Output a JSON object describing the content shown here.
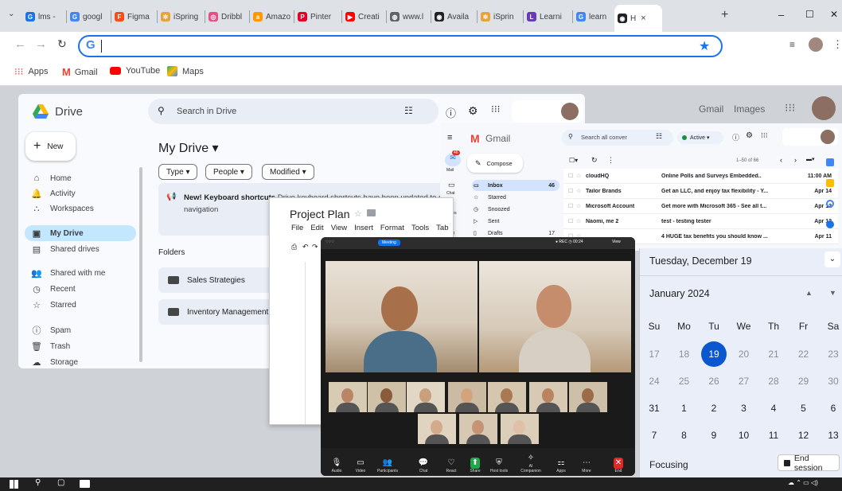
{
  "browser": {
    "tabs": [
      {
        "label": "lms -",
        "color": "#1a73e8",
        "glyph": "G"
      },
      {
        "label": "googl",
        "color": "#4285f4",
        "glyph": "G"
      },
      {
        "label": "Figma",
        "color": "#f24e1e",
        "glyph": "F"
      },
      {
        "label": "iSpring",
        "color": "#e9a23b",
        "glyph": "✲"
      },
      {
        "label": "Dribbl",
        "color": "#ea4c89",
        "glyph": "◎"
      },
      {
        "label": "Amazo",
        "color": "#ff9900",
        "glyph": "a"
      },
      {
        "label": "Pinter",
        "color": "#e60023",
        "glyph": "P"
      },
      {
        "label": "Creati",
        "color": "#ff0000",
        "glyph": "▶"
      },
      {
        "label": "www.l",
        "color": "#5f6368",
        "glyph": "◍"
      },
      {
        "label": "Availa",
        "color": "#202124",
        "glyph": "◉"
      },
      {
        "label": "iSprin",
        "color": "#e9a23b",
        "glyph": "✲"
      },
      {
        "label": "Learni",
        "color": "#673ab7",
        "glyph": "L"
      },
      {
        "label": "learn",
        "color": "#4285f4",
        "glyph": "G"
      },
      {
        "label": "H",
        "color": "#202124",
        "glyph": "◉"
      }
    ],
    "new_tab": "+",
    "tab_close": "×",
    "menu_caret": "⌄",
    "omnibox_prefix": "G",
    "window_controls": [
      "–",
      "☐",
      "✕"
    ],
    "bookmarks": [
      {
        "label": "Apps",
        "icon": "apps-grid-icon"
      },
      {
        "label": "Gmail",
        "icon": "gmail-icon"
      },
      {
        "label": "YouTube",
        "icon": "youtube-icon"
      },
      {
        "label": "Maps",
        "icon": "maps-icon"
      }
    ],
    "star": "★"
  },
  "drive": {
    "title": "Drive",
    "search_placeholder": "Search in Drive",
    "new_button": "New",
    "nav": [
      {
        "label": "Home",
        "icon": "⌂"
      },
      {
        "label": "Activity",
        "icon": "🔔"
      },
      {
        "label": "Workspaces",
        "icon": "∴"
      },
      {
        "label": "My Drive",
        "icon": "▣",
        "active": true
      },
      {
        "label": "Shared drives",
        "icon": "▤"
      },
      {
        "label": "Shared with me",
        "icon": "👥"
      },
      {
        "label": "Recent",
        "icon": "◷"
      },
      {
        "label": "Starred",
        "icon": "☆"
      },
      {
        "label": "Spam",
        "icon": "ⓘ"
      },
      {
        "label": "Trash",
        "icon": "🗑"
      },
      {
        "label": "Storage",
        "icon": "☁"
      }
    ],
    "heading": "My Drive ▾",
    "filters": [
      "Type ▾",
      "People ▾",
      "Modified ▾"
    ],
    "banner_bold": "New! Keyboard shortcuts",
    "banner_text": "Drive keyboard shortcuts have been updated to give",
    "banner_text2": "navigation",
    "folders_label": "Folders",
    "folders": [
      "Sales Strategies",
      "Inventory Management"
    ],
    "header_links": [
      "Gmail",
      "Images"
    ]
  },
  "gmail": {
    "title": "Gmail",
    "search_placeholder": "Search all conver",
    "status": "Active ▾",
    "compose": "Compose",
    "rail": [
      "Mail",
      "Chat",
      "Spaces"
    ],
    "mail_badge": "46",
    "labels": [
      {
        "label": "Inbox",
        "count": "46",
        "icon": "▭"
      },
      {
        "label": "Starred",
        "count": "",
        "icon": "☆"
      },
      {
        "label": "Snoozed",
        "count": "",
        "icon": "◷"
      },
      {
        "label": "Sent",
        "count": "",
        "icon": "▷"
      },
      {
        "label": "Drafts",
        "count": "17",
        "icon": "▯"
      }
    ],
    "pager": "1–50 of 66",
    "emails": [
      {
        "sender": "cloudHQ",
        "subject": "Online Polls and Surveys Embedded..",
        "date": "11:00 AM"
      },
      {
        "sender": "Tailor Brands",
        "subject": "Get an LLC, and enjoy tax flexibility - Y...",
        "date": "Apr 14"
      },
      {
        "sender": "Microsoft Account",
        "subject": "Get more with Microsoft 365 - See all t...",
        "date": "Apr 12"
      },
      {
        "sender": "Naomi, me 2",
        "subject": "test - testing tester",
        "date": "Apr 12"
      },
      {
        "sender": "",
        "subject": "4 HUGE tax benefits you should know ...",
        "date": "Apr 11"
      }
    ]
  },
  "docs": {
    "title": "Project Plan",
    "menu": [
      "File",
      "Edit",
      "View",
      "Insert",
      "Format",
      "Tools",
      "Tab"
    ]
  },
  "zoom": {
    "meeting_label": "Meeting",
    "rec_label": "REC",
    "timer": "00:24",
    "view_label": "View",
    "toolbar": [
      {
        "label": "Audio",
        "icon": "🎙"
      },
      {
        "label": "Video",
        "icon": "▭"
      },
      {
        "label": "Participants",
        "icon": "👥"
      },
      {
        "label": "Chat",
        "icon": "💬"
      },
      {
        "label": "React",
        "icon": "♡"
      },
      {
        "label": "Share",
        "icon": "⬆"
      },
      {
        "label": "Host tools",
        "icon": "⛨"
      },
      {
        "label": "AI Companion",
        "icon": "✧"
      },
      {
        "label": "Apps",
        "icon": "⚏"
      },
      {
        "label": "More",
        "icon": "⋯"
      },
      {
        "label": "End",
        "icon": "✕"
      }
    ]
  },
  "calendar": {
    "today_label": "Tuesday, December 19",
    "month": "January 2024",
    "weekdays": [
      "Su",
      "Mo",
      "Tu",
      "We",
      "Th",
      "Fr",
      "Sa"
    ],
    "weeks": [
      [
        "17",
        "18",
        "19",
        "20",
        "21",
        "22",
        "23"
      ],
      [
        "24",
        "25",
        "26",
        "27",
        "28",
        "29",
        "30"
      ],
      [
        "31",
        "1",
        "2",
        "3",
        "4",
        "5",
        "6"
      ],
      [
        "7",
        "8",
        "9",
        "10",
        "11",
        "12",
        "13"
      ]
    ],
    "selected": "19",
    "focus_label": "Focusing",
    "end_session": "End session"
  },
  "colors": {
    "accent": "#1a73e8",
    "drive_active": "#c2e7ff",
    "today": "#0b57d0"
  }
}
